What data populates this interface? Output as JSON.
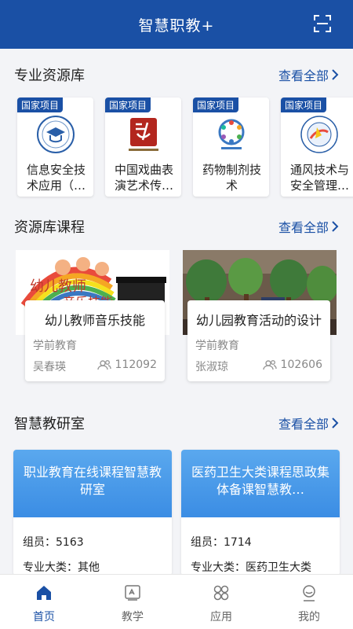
{
  "header": {
    "title": "智慧职教+"
  },
  "resource_library": {
    "title": "专业资源库",
    "see_all": "查看全部",
    "cards": [
      {
        "tag": "国家项目",
        "name": "信息安全技术应用（…"
      },
      {
        "tag": "国家项目",
        "name": "中国戏曲表演艺术传…"
      },
      {
        "tag": "国家项目",
        "name": "药物制剂技术"
      },
      {
        "tag": "国家项目",
        "name": "通风技术与安全管理…"
      }
    ]
  },
  "courses": {
    "title": "资源库课程",
    "see_all": "查看全部",
    "items": [
      {
        "title": "幼儿教师音乐技能",
        "category": "学前教育",
        "teacher": "吴春瑛",
        "views": "112092"
      },
      {
        "title": "幼儿园教育活动的设计",
        "category": "学前教育",
        "teacher": "张淑琼",
        "views": "102606"
      }
    ]
  },
  "research": {
    "title": "智慧教研室",
    "see_all": "查看全部",
    "items": [
      {
        "title": "职业教育在线课程智慧教研室",
        "members": "组员：5163",
        "major": "专业大类：其他"
      },
      {
        "title": "医药卫生大类课程思政集体备课智慧教…",
        "members": "组员：1714",
        "major": "专业大类：医药卫生大类"
      }
    ]
  },
  "tabbar": [
    {
      "label": "首页",
      "active": true
    },
    {
      "label": "教学",
      "active": false
    },
    {
      "label": "应用",
      "active": false
    },
    {
      "label": "我的",
      "active": false
    }
  ],
  "colors": {
    "brand": "#1a50a5",
    "banner": "#4a9ae9"
  }
}
